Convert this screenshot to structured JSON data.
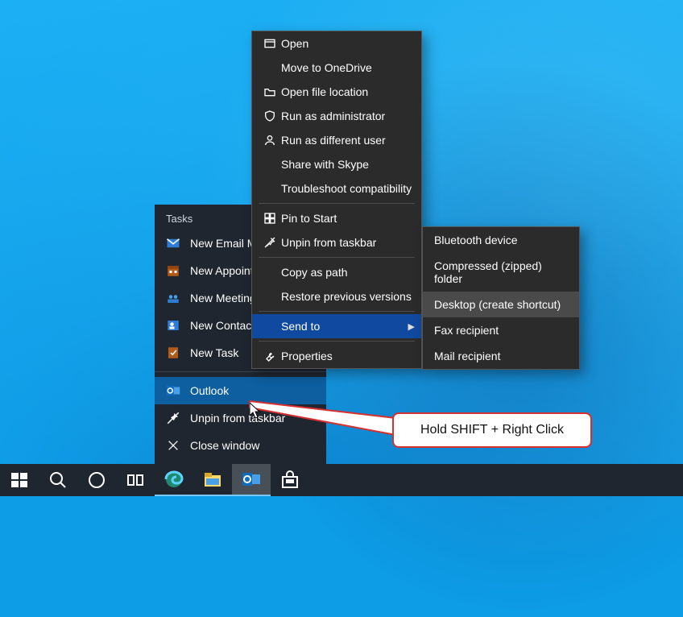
{
  "jumplist": {
    "header": "Tasks",
    "tasks": [
      {
        "icon": "mail",
        "label": "New Email Message"
      },
      {
        "icon": "calendar",
        "label": "New Appointment"
      },
      {
        "icon": "meeting",
        "label": "New Meeting"
      },
      {
        "icon": "contact",
        "label": "New Contact"
      },
      {
        "icon": "task",
        "label": "New Task"
      }
    ],
    "app": {
      "icon": "outlook",
      "label": "Outlook"
    },
    "actions": [
      {
        "icon": "unpin",
        "label": "Unpin from taskbar"
      },
      {
        "icon": "close",
        "label": "Close window"
      }
    ]
  },
  "context_menu": [
    {
      "icon": "open",
      "label": "Open"
    },
    {
      "icon": "",
      "label": "Move to OneDrive"
    },
    {
      "icon": "folder-open",
      "label": "Open file location"
    },
    {
      "icon": "shield",
      "label": "Run as administrator"
    },
    {
      "icon": "user",
      "label": "Run as different user"
    },
    {
      "icon": "",
      "label": "Share with Skype"
    },
    {
      "icon": "",
      "label": "Troubleshoot compatibility"
    },
    {
      "sep": true
    },
    {
      "icon": "pin",
      "label": "Pin to Start"
    },
    {
      "icon": "unpin",
      "label": "Unpin from taskbar"
    },
    {
      "sep": true
    },
    {
      "icon": "",
      "label": "Copy as path"
    },
    {
      "icon": "",
      "label": "Restore previous versions"
    },
    {
      "sep": true
    },
    {
      "icon": "",
      "label": "Send to",
      "submenu": true,
      "highlight": true
    },
    {
      "sep": true
    },
    {
      "icon": "wrench",
      "label": "Properties"
    }
  ],
  "submenu": [
    {
      "label": "Bluetooth device"
    },
    {
      "label": "Compressed (zipped) folder"
    },
    {
      "label": "Desktop (create shortcut)",
      "highlight": true
    },
    {
      "label": "Fax recipient"
    },
    {
      "label": "Mail recipient"
    }
  ],
  "callout": "Hold SHIFT + Right Click",
  "taskbar": [
    {
      "icon": "start",
      "name": "start"
    },
    {
      "icon": "search",
      "name": "search"
    },
    {
      "icon": "cortana",
      "name": "cortana"
    },
    {
      "icon": "taskview",
      "name": "task-view"
    },
    {
      "icon": "edge",
      "name": "edge",
      "running": true
    },
    {
      "icon": "explorer",
      "name": "file-explorer",
      "running": true
    },
    {
      "icon": "outlook",
      "name": "outlook",
      "active": true
    },
    {
      "icon": "store",
      "name": "microsoft-store"
    }
  ]
}
